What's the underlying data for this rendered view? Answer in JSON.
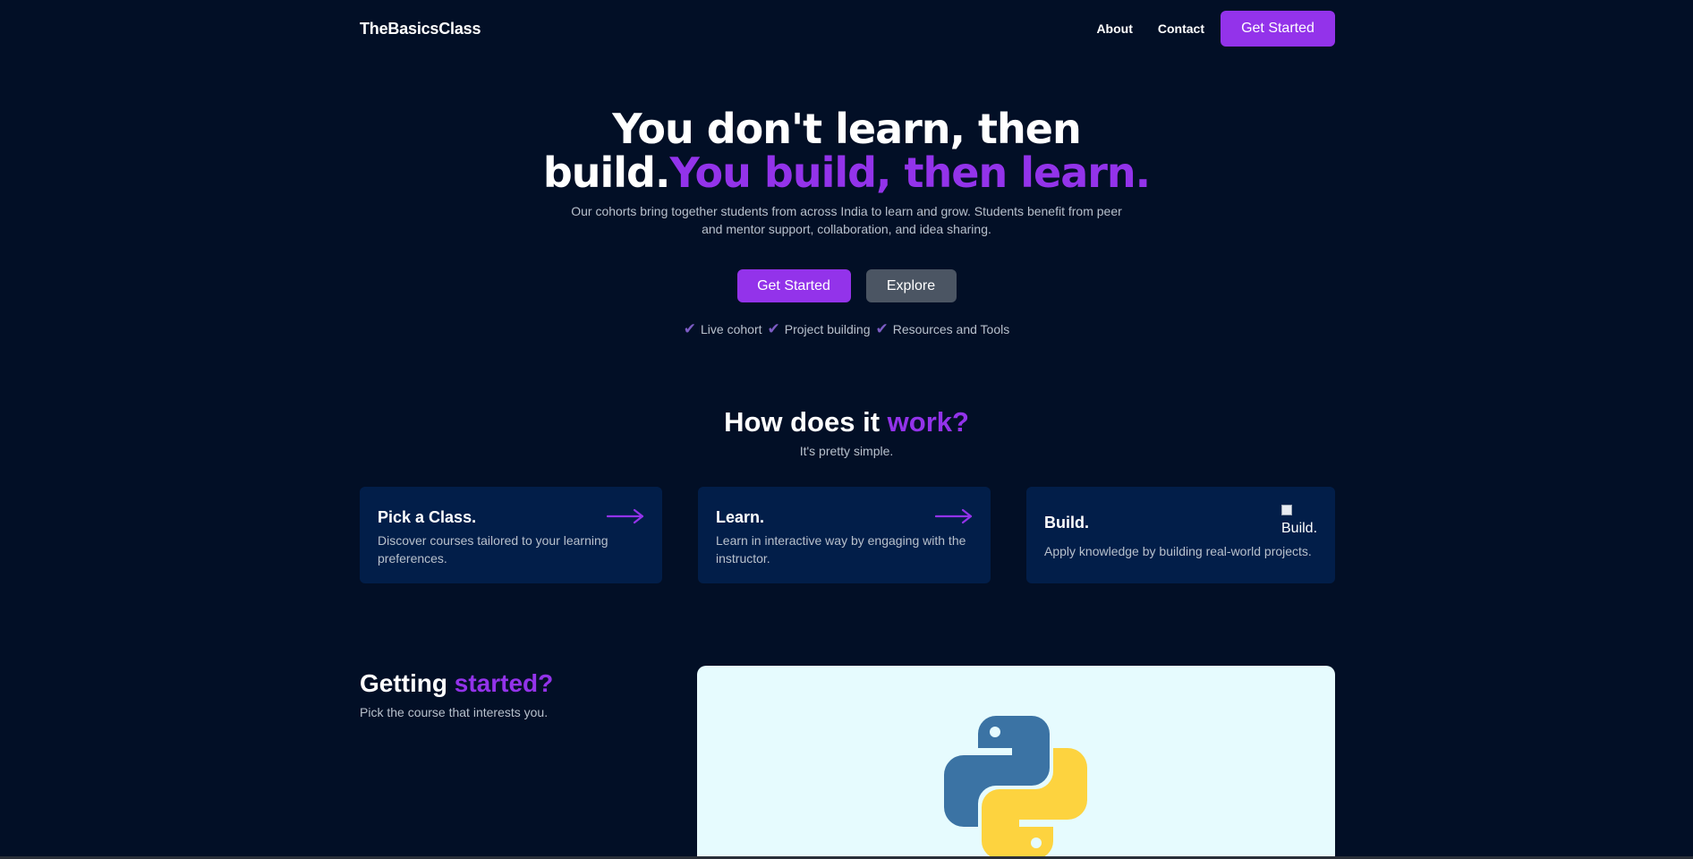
{
  "nav": {
    "brand": "TheBasicsClass",
    "links": [
      "About",
      "Contact"
    ],
    "cta": "Get Started"
  },
  "hero": {
    "title_line1": "You don't learn, then",
    "title_line2_white": "build.",
    "title_line2_accent": "You build, then learn.",
    "subtitle": "Our cohorts bring together students from across India to learn and grow. Students benefit from peer and mentor support, collaboration, and idea sharing.",
    "primary_button": "Get Started",
    "secondary_button": "Explore",
    "features": [
      "Live cohort",
      "Project building",
      "Resources and Tools"
    ]
  },
  "how": {
    "title_white": "How does it ",
    "title_accent": "work?",
    "subtitle": "It's pretty simple.",
    "cards": [
      {
        "title": "Pick a Class.",
        "desc": "Discover courses tailored to your learning preferences.",
        "icon": "arrow-right-icon"
      },
      {
        "title": "Learn.",
        "desc": "Learn in interactive way by engaging with the instructor.",
        "icon": "arrow-right-icon"
      },
      {
        "title": "Build.",
        "desc": "Apply knowledge by building real-world projects.",
        "img_alt": "Build."
      }
    ]
  },
  "getting_started": {
    "title_white": "Getting ",
    "title_accent": "started?",
    "subtitle": "Pick the course that interests you.",
    "course_logo": "python-logo"
  },
  "colors": {
    "background": "#020f26",
    "accent": "#9333ea",
    "card": "#021e49",
    "muted_text": "#b8c0cc",
    "secondary_button": "#4b5563",
    "course_card_bg": "#e6fbfe"
  }
}
